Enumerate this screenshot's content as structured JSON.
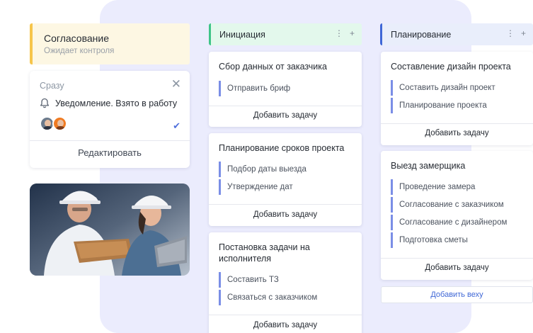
{
  "status_card": {
    "title": "Согласование",
    "subtitle": "Ожидает контроля"
  },
  "notification": {
    "timing": "Сразу",
    "text": "Уведомление. Взято в работу",
    "edit_label": "Редактировать"
  },
  "columns": [
    {
      "title": "Инициация",
      "cards": [
        {
          "title": "Сбор данных от заказчика",
          "subtasks": [
            "Отправить бриф"
          ],
          "add_label": "Добавить задачу"
        },
        {
          "title": "Планирование сроков проекта",
          "subtasks": [
            "Подбор даты выезда",
            "Утверждение дат"
          ],
          "add_label": "Добавить задачу"
        },
        {
          "title": "Постановка задачи на исполнителя",
          "subtasks": [
            "Составить ТЗ",
            "Связаться с заказчиком"
          ],
          "add_label": "Добавить задачу"
        }
      ]
    },
    {
      "title": "Планирование",
      "cards": [
        {
          "title": "Составление дизайн проекта",
          "subtasks": [
            "Составить дизайн проект",
            "Планирование проекта"
          ],
          "add_label": "Добавить задачу"
        },
        {
          "title": "Выезд замерщика",
          "subtasks": [
            "Проведение замера",
            "Согласование с заказчиком",
            "Согласование с дизайнером",
            "Подготовка сметы"
          ],
          "add_label": "Добавить задачу"
        }
      ],
      "milestone_label": "Добавить веху"
    }
  ],
  "colors": {
    "accent": "#3f67d6",
    "init_accent": "#3ec488",
    "status_accent": "#f6c54b",
    "panel_bg": "#ebecfd"
  }
}
